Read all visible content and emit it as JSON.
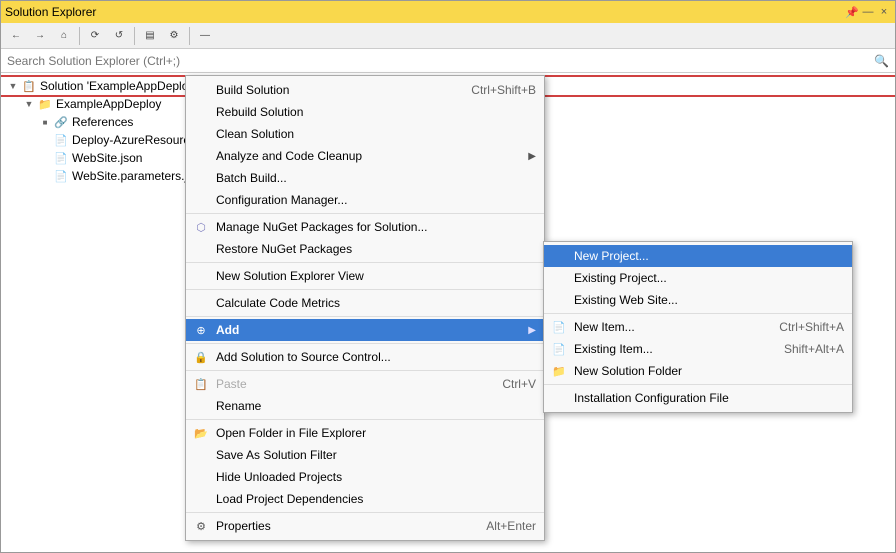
{
  "titleBar": {
    "title": "Solution Explorer",
    "pinLabel": "Pin",
    "closeLabel": "×",
    "dockLabel": "—"
  },
  "toolbar": {
    "buttons": [
      "←",
      "→",
      "⌂",
      "⚙",
      "⟳",
      "✎",
      "▤",
      "⚒",
      "—"
    ]
  },
  "search": {
    "placeholder": "Search Solution Explorer (Ctrl+;)"
  },
  "tree": {
    "items": [
      {
        "id": "solution",
        "label": "Solution 'ExampleAppDeploy'",
        "indent": 0,
        "expand": "▼",
        "icon": "📋",
        "selected": true
      },
      {
        "id": "project",
        "label": "ExampleAppDeploy",
        "indent": 1,
        "expand": "▼",
        "icon": "📁"
      },
      {
        "id": "references",
        "label": "References",
        "indent": 2,
        "expand": "▶",
        "icon": "🔗"
      },
      {
        "id": "deploy",
        "label": "Deploy-AzureResourceG...",
        "indent": 2,
        "expand": "",
        "icon": "📄"
      },
      {
        "id": "website",
        "label": "WebSite.json",
        "indent": 2,
        "expand": "",
        "icon": "📄"
      },
      {
        "id": "websiteparams",
        "label": "WebSite.parameters.json...",
        "indent": 2,
        "expand": "",
        "icon": "📄"
      }
    ]
  },
  "contextMenu": {
    "items": [
      {
        "id": "build",
        "label": "Build Solution",
        "shortcut": "Ctrl+Shift+B",
        "icon": ""
      },
      {
        "id": "rebuild",
        "label": "Rebuild Solution",
        "shortcut": "",
        "icon": ""
      },
      {
        "id": "clean",
        "label": "Clean Solution",
        "shortcut": "",
        "icon": ""
      },
      {
        "id": "analyze",
        "label": "Analyze and Code Cleanup",
        "shortcut": "",
        "icon": "",
        "arrow": "▶"
      },
      {
        "id": "batchbuild",
        "label": "Batch Build...",
        "shortcut": "",
        "icon": ""
      },
      {
        "id": "configmgr",
        "label": "Configuration Manager...",
        "shortcut": "",
        "icon": ""
      },
      {
        "id": "separator1",
        "type": "sep"
      },
      {
        "id": "nuget",
        "label": "Manage NuGet Packages for Solution...",
        "shortcut": "",
        "icon": "nuget"
      },
      {
        "id": "restore",
        "label": "Restore NuGet Packages",
        "shortcut": "",
        "icon": ""
      },
      {
        "id": "separator2",
        "type": "sep"
      },
      {
        "id": "solutionview",
        "label": "New Solution Explorer View",
        "shortcut": "",
        "icon": ""
      },
      {
        "id": "separator3",
        "type": "sep"
      },
      {
        "id": "codemetrics",
        "label": "Calculate Code Metrics",
        "shortcut": "",
        "icon": ""
      },
      {
        "id": "separator4",
        "type": "sep"
      },
      {
        "id": "add",
        "label": "Add",
        "shortcut": "",
        "icon": "add",
        "arrow": "▶",
        "highlighted": true
      },
      {
        "id": "separator5",
        "type": "sep"
      },
      {
        "id": "addsource",
        "label": "Add Solution to Source Control...",
        "shortcut": "",
        "icon": "source"
      },
      {
        "id": "separator6",
        "type": "sep"
      },
      {
        "id": "paste",
        "label": "Paste",
        "shortcut": "Ctrl+V",
        "icon": "paste",
        "disabled": true
      },
      {
        "id": "rename",
        "label": "Rename",
        "shortcut": "",
        "icon": ""
      },
      {
        "id": "separator7",
        "type": "sep"
      },
      {
        "id": "openfolder",
        "label": "Open Folder in File Explorer",
        "shortcut": "",
        "icon": "folder"
      },
      {
        "id": "savefilter",
        "label": "Save As Solution Filter",
        "shortcut": "",
        "icon": ""
      },
      {
        "id": "hideunloaded",
        "label": "Hide Unloaded Projects",
        "shortcut": "",
        "icon": ""
      },
      {
        "id": "loaddeps",
        "label": "Load Project Dependencies",
        "shortcut": "",
        "icon": ""
      },
      {
        "id": "separator8",
        "type": "sep"
      },
      {
        "id": "properties",
        "label": "Properties",
        "shortcut": "Alt+Enter",
        "icon": "properties"
      }
    ]
  },
  "submenu": {
    "items": [
      {
        "id": "newproject",
        "label": "New Project...",
        "shortcut": "",
        "icon": "",
        "highlighted": true
      },
      {
        "id": "existingproject",
        "label": "Existing Project...",
        "shortcut": "",
        "icon": ""
      },
      {
        "id": "existingwebsite",
        "label": "Existing Web Site...",
        "shortcut": "",
        "icon": ""
      },
      {
        "id": "separator1",
        "type": "sep"
      },
      {
        "id": "newitem",
        "label": "New Item...",
        "shortcut": "Ctrl+Shift+A",
        "icon": "newitem"
      },
      {
        "id": "existingitem",
        "label": "Existing Item...",
        "shortcut": "Shift+Alt+A",
        "icon": "existitem"
      },
      {
        "id": "newfolder",
        "label": "New Solution Folder",
        "shortcut": "",
        "icon": "newfolder"
      },
      {
        "id": "separator2",
        "type": "sep"
      },
      {
        "id": "installconfig",
        "label": "Installation Configuration File",
        "shortcut": "",
        "icon": ""
      }
    ]
  }
}
